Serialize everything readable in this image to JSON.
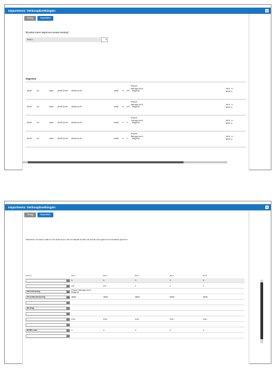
{
  "page1": {
    "title": "Importeren: Verkoopboekingen",
    "back_label": "Terug",
    "import_label": "Importeer",
    "question": "Bij welke kolom begint een nieuwe boeking?",
    "kolom_label": "Kolom",
    "kolom_value": "5",
    "section_label": "Gegevens",
    "rows": [
      {
        "year": "2015",
        "period": "12",
        "status": "draft",
        "date1": "2015-12-07",
        "date2": "2016-01-07",
        "currency": "EUR",
        "n1": "5",
        "n2": "0.5",
        "desc": [
          "Project",
          "Management",
          "- Dagprijs"
        ],
        "tr1": "21%",
        "tr2": "BTW",
        "tv1": "C",
        "tv2": "k"
      },
      {
        "year": "2015",
        "period": "12",
        "status": "draft",
        "date1": "2015-12-07",
        "date2": "2016-01-07",
        "currency": "EUR",
        "n1": "5",
        "n2": "0.5",
        "desc": [
          "Project",
          "Management",
          "- Dagprijs"
        ],
        "tr1": "21%",
        "tr2": "BTW",
        "tv1": "C",
        "tv2": "k"
      },
      {
        "year": "2015",
        "period": "12",
        "status": "draft",
        "date1": "2015-12-07",
        "date2": "2016-01-07",
        "currency": "EUR",
        "n1": "5",
        "n2": "1",
        "desc": [
          "Project",
          "management",
          "- Dagprijs"
        ],
        "tr1": "21%",
        "tr2": "BTW",
        "tv1": "C",
        "tv2": "k"
      },
      {
        "year": "2015",
        "period": "12",
        "status": "draft",
        "date1": "2015-12-07",
        "date2": "2016-01-07",
        "currency": "EUR",
        "n1": "5",
        "n2": "1",
        "desc": [
          "Project",
          "Management",
          "- Dagprijs"
        ],
        "tr1": "21%",
        "tr2": "BTW",
        "tv1": "C",
        "tv2": "k"
      }
    ]
  },
  "page2": {
    "title": "Importeren: Verkoopboekingen",
    "back_label": "Terug",
    "import_label": "Importeer",
    "info": "Selecteer met deze velden in de kolommen. Als voorbeeld worden de eerste vijf regels uit uw bestand getoond.",
    "headers": [
      "Kolom",
      "Rij 1",
      "Rij 2",
      "Rij 3",
      "Rij 4",
      "Rij 5"
    ],
    "rows": [
      {
        "select": "",
        "values": [
          "5",
          "5",
          "5",
          "5",
          "5"
        ],
        "shade": true
      },
      {
        "select": "",
        "values": [
          "0.5",
          "0.5",
          "1",
          "1",
          "1"
        ],
        "shade": false
      },
      {
        "select": "Omschrijving",
        "values": [
          "Project Management - Dagprijs",
          "",
          "",
          "",
          ""
        ],
        "shade": false,
        "multiline": [
          "Project Management -",
          "Dagprijs"
        ]
      },
      {
        "select": "Grondbeslistening",
        "values": [
          "4000",
          "4000",
          "3000",
          "3000",
          "3000"
        ],
        "shade": false
      },
      {
        "select": "",
        "values": [
          "",
          "",
          "",
          "",
          ""
        ],
        "shade": false
      },
      {
        "select": "Bedrag",
        "values": [
          "",
          "",
          "",
          "",
          ""
        ],
        "shade": false
      },
      {
        "select": "",
        "values": [
          "",
          "",
          "",
          "",
          ""
        ],
        "shade": false
      },
      {
        "select": "",
        "values": [
          "0.21",
          "0.21",
          "0.21",
          "0.21",
          "0.21"
        ],
        "shade": false
      },
      {
        "select": "",
        "values": [
          "",
          "",
          "",
          "",
          ""
        ],
        "shade": false
      },
      {
        "select": "BTW-code",
        "values": [
          "2",
          "2",
          "2",
          "2",
          "2"
        ],
        "shade": false
      },
      {
        "select": "",
        "values": [
          "",
          "",
          "",
          "",
          ""
        ],
        "shade": false
      }
    ]
  },
  "colors": {
    "accent": "#1a76c4",
    "secondary_button": "#8c8c8c"
  }
}
